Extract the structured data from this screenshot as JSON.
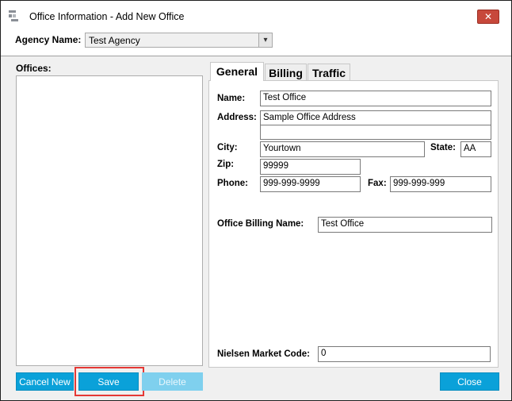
{
  "window": {
    "title": "Office Information - Add New Office",
    "close_glyph": "✕"
  },
  "agency": {
    "label": "Agency Name:",
    "value": "Test Agency",
    "arrow_glyph": "▾"
  },
  "offices": {
    "label": "Offices:",
    "items": []
  },
  "tabs": [
    {
      "label": "General",
      "active": true
    },
    {
      "label": "Billing",
      "active": false
    },
    {
      "label": "Traffic",
      "active": false
    }
  ],
  "general": {
    "name_label": "Name:",
    "name_value": "Test Office",
    "address_label": "Address:",
    "address_line1": "Sample Office Address",
    "address_line2": "",
    "city_label": "City:",
    "city_value": "Yourtown",
    "state_label": "State:",
    "state_value": "AA",
    "zip_label": "Zip:",
    "zip_value": "99999",
    "phone_label": "Phone:",
    "phone_value": "999-999-9999",
    "fax_label": "Fax:",
    "fax_value": "999-999-999",
    "billing_name_label": "Office Billing Name:",
    "billing_name_value": "Test Office",
    "nielsen_label": "Nielsen Market Code:",
    "nielsen_value": "0"
  },
  "buttons": {
    "cancel_new": "Cancel New",
    "save": "Save",
    "delete": "Delete",
    "close": "Close"
  },
  "colors": {
    "accent": "#0aa1d9",
    "highlight": "#e53935",
    "close_red": "#c7483b"
  }
}
